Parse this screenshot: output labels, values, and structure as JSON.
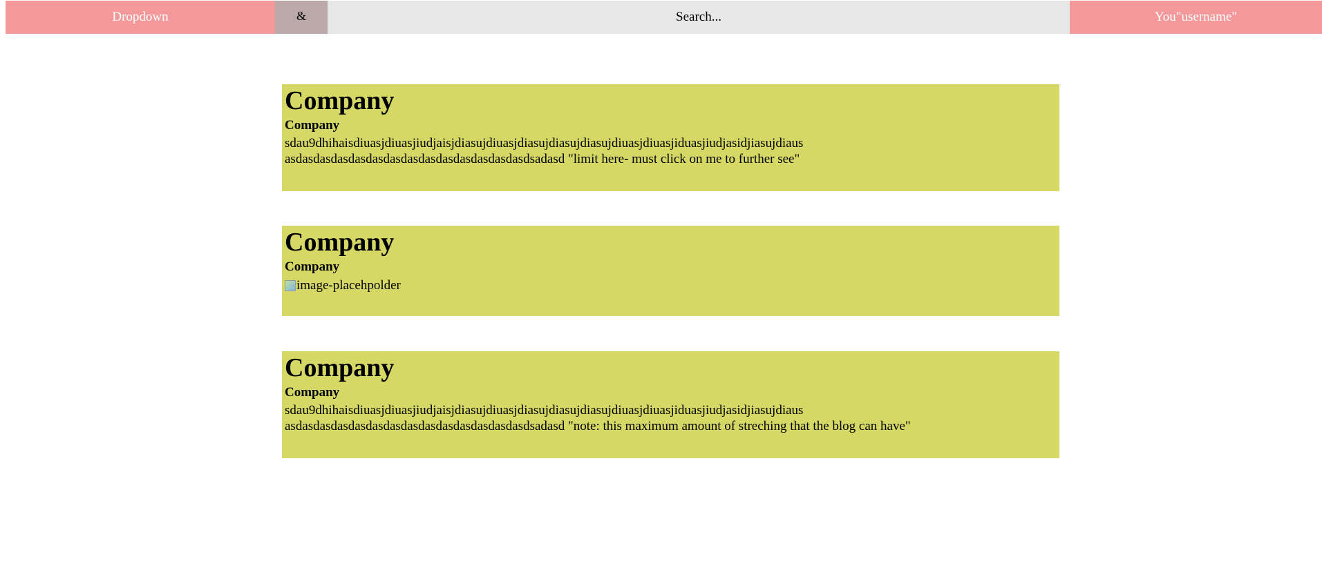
{
  "header": {
    "dropdown_label": "Dropdown",
    "amp_label": "&",
    "search_placeholder": "Search...",
    "user_label": "You\"username\""
  },
  "posts": [
    {
      "title": "Company",
      "subtitle": "Company",
      "body": "sdau9dhihaisdiuasjdiuasjiudjaisjdiasujdiuasjdiasujdiasujdiasujdiuasjdiuasjiduasjiudjasidjiasujdiaus\nasdasdasdasdasdasdasdasdasdasdasdasdasdasdsadasd \"limit here- must click on me to further see\""
    },
    {
      "title": "Company",
      "subtitle": "Company",
      "image_alt": "image-placehpolder"
    },
    {
      "title": "Company",
      "subtitle": "Company",
      "body": "sdau9dhihaisdiuasjdiuasjiudjaisjdiasujdiuasjdiasujdiasujdiasujdiuasjdiuasjiduasjiudjasidjiasujdiaus\nasdasdasdasdasdasdasdasdasdasdasdasdasdasdsadasd \"note: this maximum amount of streching that the blog can have\""
    }
  ],
  "colors": {
    "nav_pink": "#f4999b",
    "amp_bg": "#bba9aa",
    "search_bg": "#e7e7e7",
    "post_bg": "#d5d864"
  }
}
